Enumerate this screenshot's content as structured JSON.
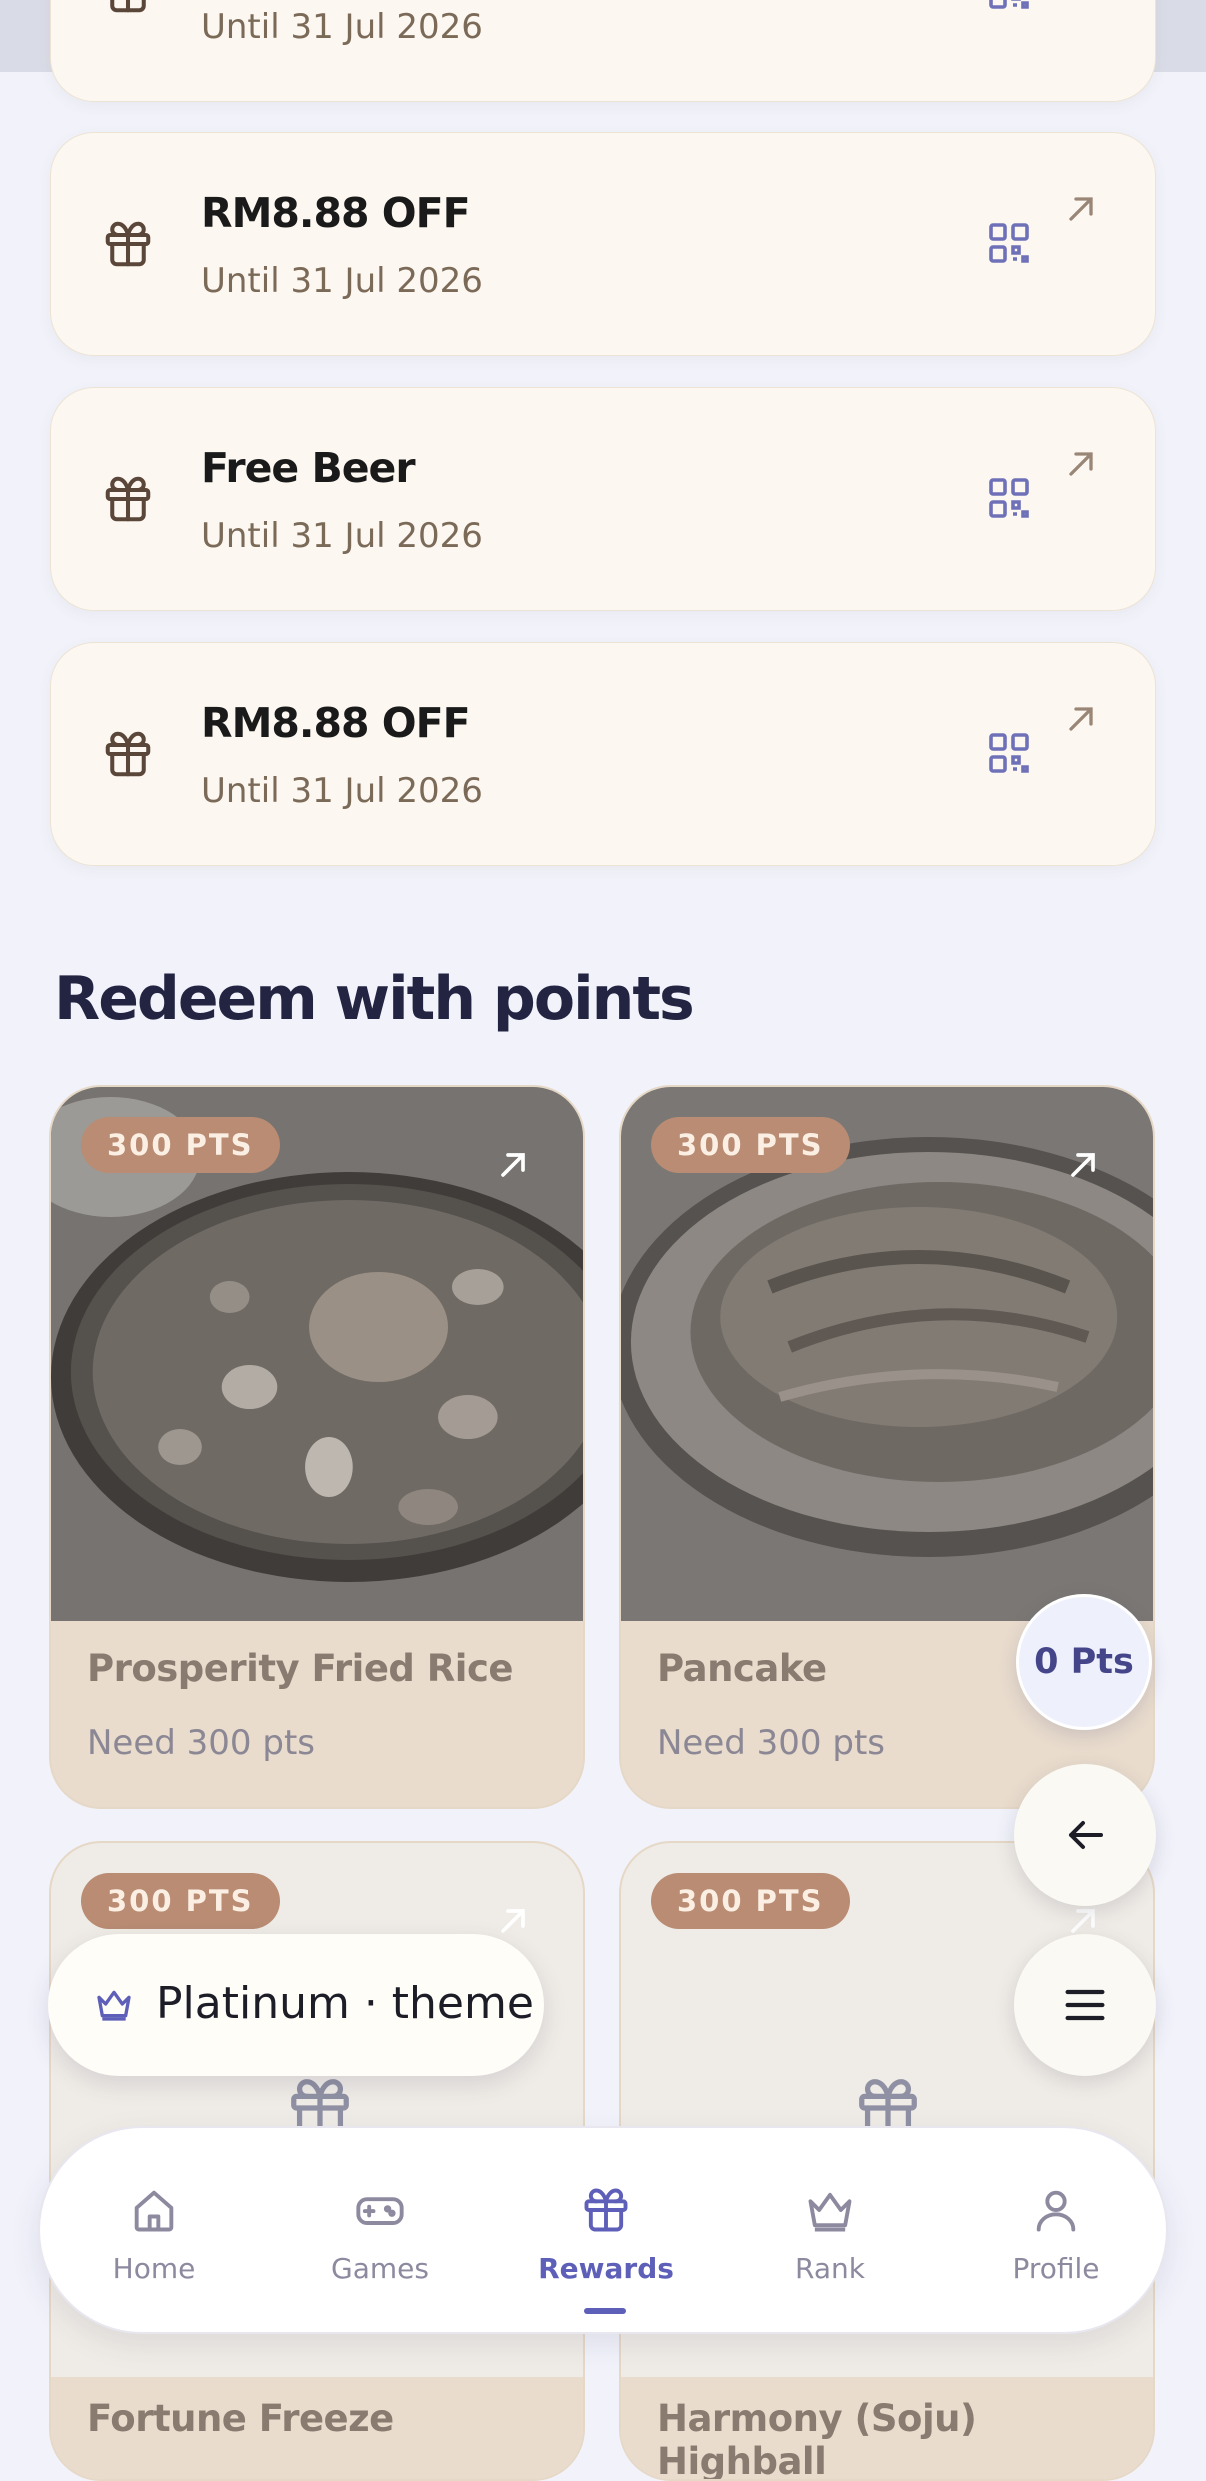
{
  "vouchers": [
    {
      "title": "",
      "until": "Until 31 Jul 2026"
    },
    {
      "title": "RM8.88 OFF",
      "until": "Until 31 Jul 2026"
    },
    {
      "title": "Free Beer",
      "until": "Until 31 Jul 2026"
    },
    {
      "title": "RM8.88 OFF",
      "until": "Until 31 Jul 2026"
    }
  ],
  "redeem": {
    "title": "Redeem with points",
    "items": [
      {
        "badge": "300 PTS",
        "name": "Prosperity Fried Rice",
        "need": "Need 300 pts"
      },
      {
        "badge": "300 PTS",
        "name": "Pancake",
        "need": "Need 300 pts"
      },
      {
        "badge": "300 PTS",
        "name": "Fortune Freeze",
        "need": ""
      },
      {
        "badge": "300 PTS",
        "name": "Harmony (Soju) Highball",
        "need": ""
      }
    ]
  },
  "floating": {
    "points": "0 Pts"
  },
  "theme": {
    "label": "Platinum · theme"
  },
  "nav": {
    "items": [
      {
        "label": "Home",
        "icon": "home-icon"
      },
      {
        "label": "Games",
        "icon": "gamepad-icon"
      },
      {
        "label": "Rewards",
        "icon": "gift-icon",
        "active": true
      },
      {
        "label": "Rank",
        "icon": "crown-icon"
      },
      {
        "label": "Profile",
        "icon": "user-icon"
      }
    ]
  },
  "colors": {
    "accent": "#5e5fb8",
    "badge": "#b98c73",
    "card": "#fcf8f1"
  }
}
